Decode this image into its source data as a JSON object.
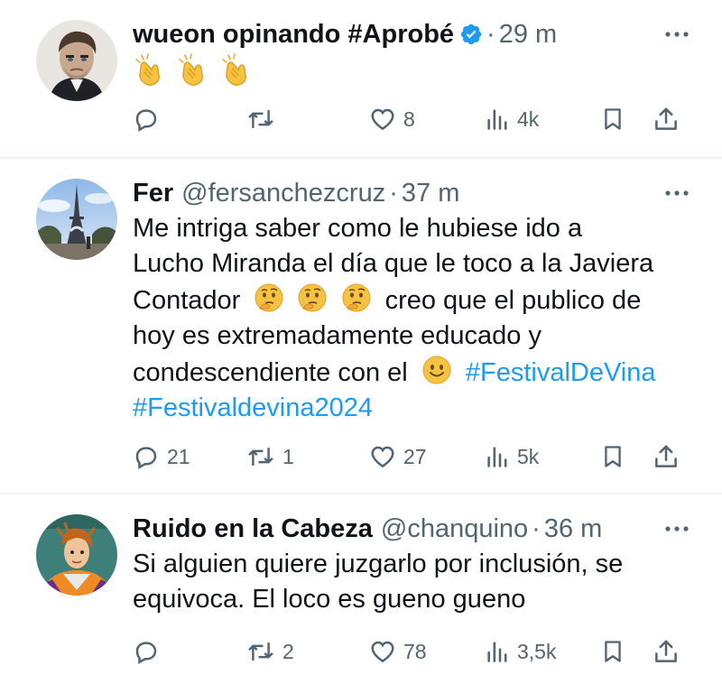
{
  "tweets": [
    {
      "name": "wueon opinando #Aprobé",
      "handle": "",
      "time": "29 m",
      "verified": true,
      "text": "",
      "emojis": [
        "clapping-hands",
        "clapping-hands",
        "clapping-hands"
      ],
      "replies": "",
      "retweets": "",
      "likes": "8",
      "views": "4k"
    },
    {
      "name": "Fer",
      "handle": "@fersanchezcruz",
      "time": "37 m",
      "line1": "Me intriga saber como le hubiese ido a",
      "line2": "Lucho Miranda el día que le toco a la Javiera",
      "line3a": "Contador",
      "line3b": "creo que el publico de",
      "line4": "hoy es extremadamente educado y",
      "line5": "condescendiente con el",
      "hashtag1": "#FestivalDeVina",
      "hashtag2": "#Festivaldevina2024",
      "replies": "21",
      "retweets": "1",
      "likes": "27",
      "views": "5k"
    },
    {
      "name": "Ruido en la Cabeza",
      "handle": "@chanquino",
      "time": "36 m",
      "line1": "Si alguien quiere juzgarlo por inclusión, se",
      "line2": "equivoca. El loco es gueno gueno",
      "replies": "",
      "retweets": "2",
      "likes": "78",
      "views": "3,5k"
    }
  ],
  "separator": "·",
  "colors": {
    "text": "#0f1419",
    "secondary": "#536471",
    "hashtag": "#1d9bf0",
    "verified": "#1d9bf0",
    "divider": "#eff3f4"
  },
  "icons": [
    "reply-icon",
    "retweet-icon",
    "like-icon",
    "views-icon",
    "bookmark-icon",
    "share-icon",
    "more-icon",
    "verified-icon"
  ]
}
